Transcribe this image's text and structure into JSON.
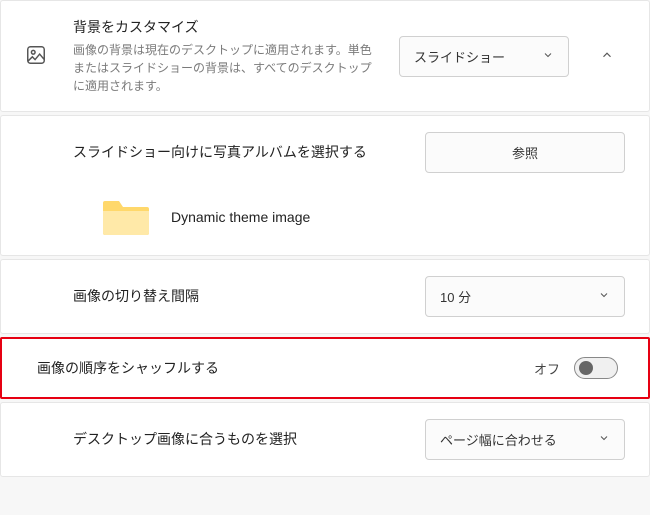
{
  "background": {
    "title": "背景をカスタマイズ",
    "desc": "画像の背景は現在のデスクトップに適用されます。単色またはスライドショーの背景は、すべてのデスクトップに適用されます。",
    "type_value": "スライドショー"
  },
  "album": {
    "label": "スライドショー向けに写真アルバムを選択する",
    "browse_button": "参照",
    "folder_name": "Dynamic theme image"
  },
  "interval": {
    "label": "画像の切り替え間隔",
    "value": "10 分"
  },
  "shuffle": {
    "label": "画像の順序をシャッフルする",
    "state": "オフ"
  },
  "fit": {
    "label": "デスクトップ画像に合うものを選択",
    "value": "ページ幅に合わせる"
  }
}
